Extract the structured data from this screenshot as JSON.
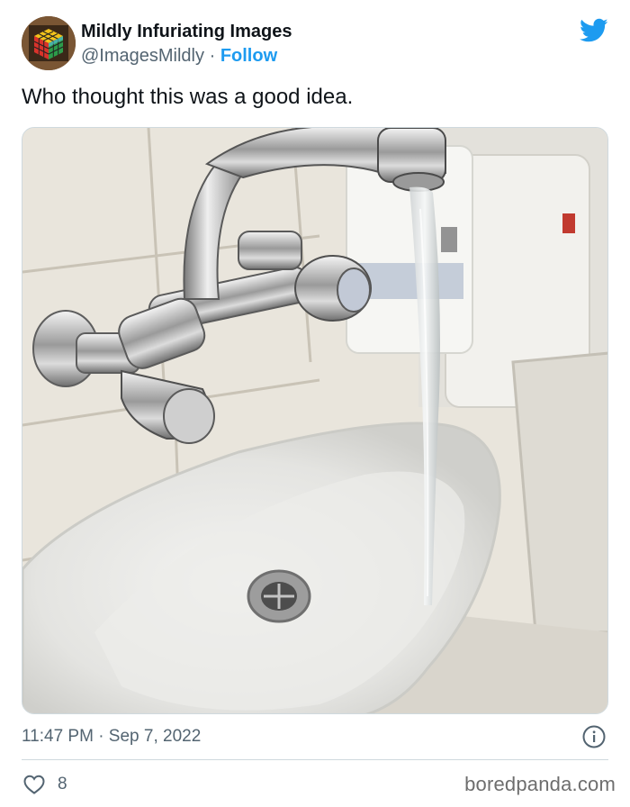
{
  "tweet": {
    "display_name": "Mildly Infuriating Images",
    "handle": "@ImagesMildly",
    "separator": "·",
    "follow_label": "Follow",
    "text": "Who thought this was a good idea.",
    "timestamp": "11:47 PM · Sep 7, 2022",
    "like_count": "8",
    "avatar": "rubiks-cube-avatar",
    "media": "photo of faucet spout pouring water beyond the edge of a small sink"
  },
  "icons": {
    "logo": "twitter-bird-icon",
    "info": "info-icon",
    "like": "heart-icon"
  },
  "colors": {
    "link": "#1d9bf0",
    "secondary_text": "#536471",
    "primary_text": "#0f1419",
    "border": "#cfd9de"
  },
  "watermark": "boredpanda.com"
}
